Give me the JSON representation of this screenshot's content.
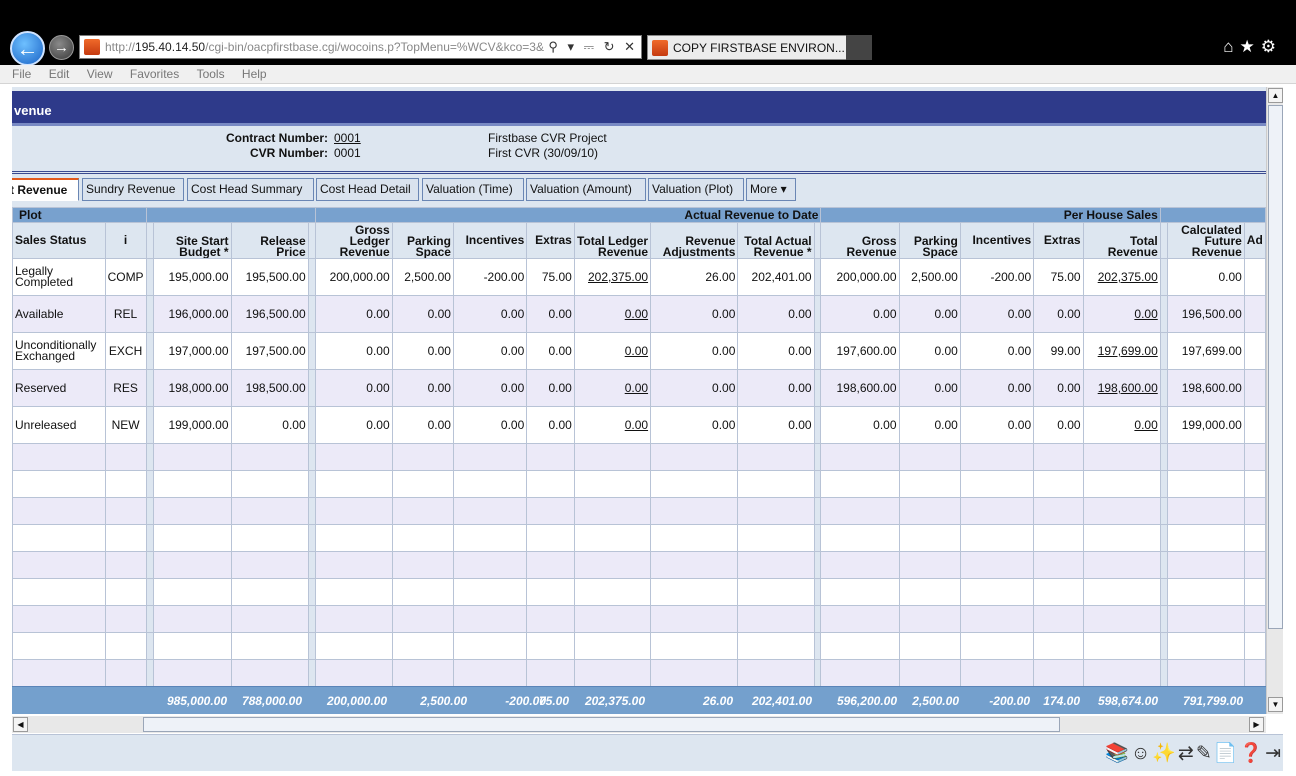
{
  "browser": {
    "url": "http://195.40.14.50/cgi-bin/oacpfirstbase.cgi/wocoins.p?TopMenu=%WCV&kco=3&",
    "url_prefix": "http://",
    "url_host": "195.40.14.50",
    "url_path": "/cgi-bin/oacpfirstbase.cgi/wocoins.p?TopMenu=%WCV&kco=3&",
    "tab_title": "COPY FIRSTBASE ENVIRON...",
    "menu": [
      "File",
      "Edit",
      "View",
      "Favorites",
      "Tools",
      "Help"
    ]
  },
  "page": {
    "title": "venue",
    "contract_number_label": "Contract Number:",
    "contract_number": "0001",
    "cvr_number_label": "CVR Number:",
    "cvr_number": "0001",
    "project_name": "Firstbase CVR Project",
    "cvr_name": "First CVR (30/09/10)"
  },
  "tabs": [
    "t Revenue",
    "Sundry Revenue",
    "Cost Head Summary",
    "Cost Head Detail",
    "Valuation (Time)",
    "Valuation (Amount)",
    "Valuation (Plot)",
    "More ▾"
  ],
  "groups": {
    "plot": "Plot",
    "actual": "Actual Revenue to Date",
    "per_house": "Per House Sales"
  },
  "columns": {
    "sales_status": "Sales Status",
    "i": "i",
    "site_start_budget": "Site Start Budget *",
    "release_price": "Release Price",
    "gross_ledger_revenue": "Gross Ledger Revenue",
    "parking_space": "Parking Space",
    "incentives": "Incentives",
    "extras": "Extras",
    "total_ledger_revenue": "Total Ledger Revenue",
    "revenue_adjustments": "Revenue Adjustments",
    "total_actual_revenue": "Total Actual Revenue *",
    "gross_revenue": "Gross Revenue",
    "ph_parking_space": "Parking Space",
    "ph_incentives": "Incentives",
    "ph_extras": "Extras",
    "total_revenue": "Total Revenue",
    "calc_future_revenue": "Calculated Future Revenue",
    "ad": "Ad"
  },
  "rows": [
    [
      "Legally Completed",
      "COMP",
      "195,000.00",
      "195,500.00",
      "200,000.00",
      "2,500.00",
      "-200.00",
      "75.00",
      "202,375.00",
      "26.00",
      "202,401.00",
      "200,000.00",
      "2,500.00",
      "-200.00",
      "75.00",
      "202,375.00",
      "0.00"
    ],
    [
      "Available",
      "REL",
      "196,000.00",
      "196,500.00",
      "0.00",
      "0.00",
      "0.00",
      "0.00",
      "0.00",
      "0.00",
      "0.00",
      "0.00",
      "0.00",
      "0.00",
      "0.00",
      "0.00",
      "196,500.00"
    ],
    [
      "Unconditionally Exchanged",
      "EXCH",
      "197,000.00",
      "197,500.00",
      "0.00",
      "0.00",
      "0.00",
      "0.00",
      "0.00",
      "0.00",
      "0.00",
      "197,600.00",
      "0.00",
      "0.00",
      "99.00",
      "197,699.00",
      "197,699.00"
    ],
    [
      "Reserved",
      "RES",
      "198,000.00",
      "198,500.00",
      "0.00",
      "0.00",
      "0.00",
      "0.00",
      "0.00",
      "0.00",
      "0.00",
      "198,600.00",
      "0.00",
      "0.00",
      "0.00",
      "198,600.00",
      "198,600.00"
    ],
    [
      "Unreleased",
      "NEW",
      "199,000.00",
      "0.00",
      "0.00",
      "0.00",
      "0.00",
      "0.00",
      "0.00",
      "0.00",
      "0.00",
      "0.00",
      "0.00",
      "0.00",
      "0.00",
      "0.00",
      "199,000.00"
    ]
  ],
  "totals": [
    "985,000.00",
    "788,000.00",
    "200,000.00",
    "2,500.00",
    "-200.00",
    "75.00",
    "202,375.00",
    "26.00",
    "202,401.00",
    "596,200.00",
    "2,500.00",
    "-200.00",
    "174.00",
    "598,674.00",
    "791,799.00"
  ]
}
